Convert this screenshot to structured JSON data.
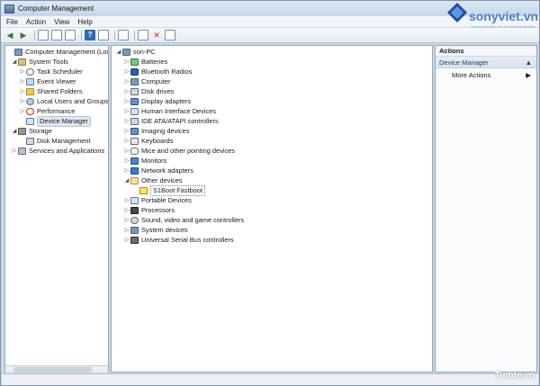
{
  "window": {
    "title": "Computer Management"
  },
  "menu": [
    "File",
    "Action",
    "View",
    "Help"
  ],
  "left_tree": [
    {
      "label": "Computer Management (Local",
      "icon": "computer-icon"
    },
    {
      "label": "System Tools",
      "icon": "tools-icon"
    },
    {
      "label": "Task Scheduler",
      "icon": "clock-icon"
    },
    {
      "label": "Event Viewer",
      "icon": "event-viewer-icon"
    },
    {
      "label": "Shared Folders",
      "icon": "folder-icon"
    },
    {
      "label": "Local Users and Groups",
      "icon": "users-icon"
    },
    {
      "label": "Performance",
      "icon": "performance-icon"
    },
    {
      "label": "Device Manager",
      "icon": "device-manager-icon"
    },
    {
      "label": "Storage",
      "icon": "storage-icon"
    },
    {
      "label": "Disk Management",
      "icon": "disk-icon"
    },
    {
      "label": "Services and Applications",
      "icon": "services-icon"
    }
  ],
  "device_tree": {
    "root": "son-PC",
    "items": [
      "Batteries",
      "Bluetooth Radios",
      "Computer",
      "Disk drives",
      "Display adapters",
      "Human Interface Devices",
      "IDE ATA/ATAPI controllers",
      "Imaging devices",
      "Keyboards",
      "Mice and other pointing devices",
      "Monitors",
      "Network adapters",
      "Other devices",
      "S1Boot Fastboot",
      "Portable Devices",
      "Processors",
      "Sound, video and game controllers",
      "System devices",
      "Universal Serial Bus controllers"
    ]
  },
  "actions": {
    "header": "Actions",
    "section": "Device Manager",
    "item": "More Actions"
  },
  "watermark": {
    "site": "sonyviet.vn",
    "tagline": "Chung một đam mê, sẻ chia trải nghiệm",
    "footer": "Tinhte.vn"
  }
}
